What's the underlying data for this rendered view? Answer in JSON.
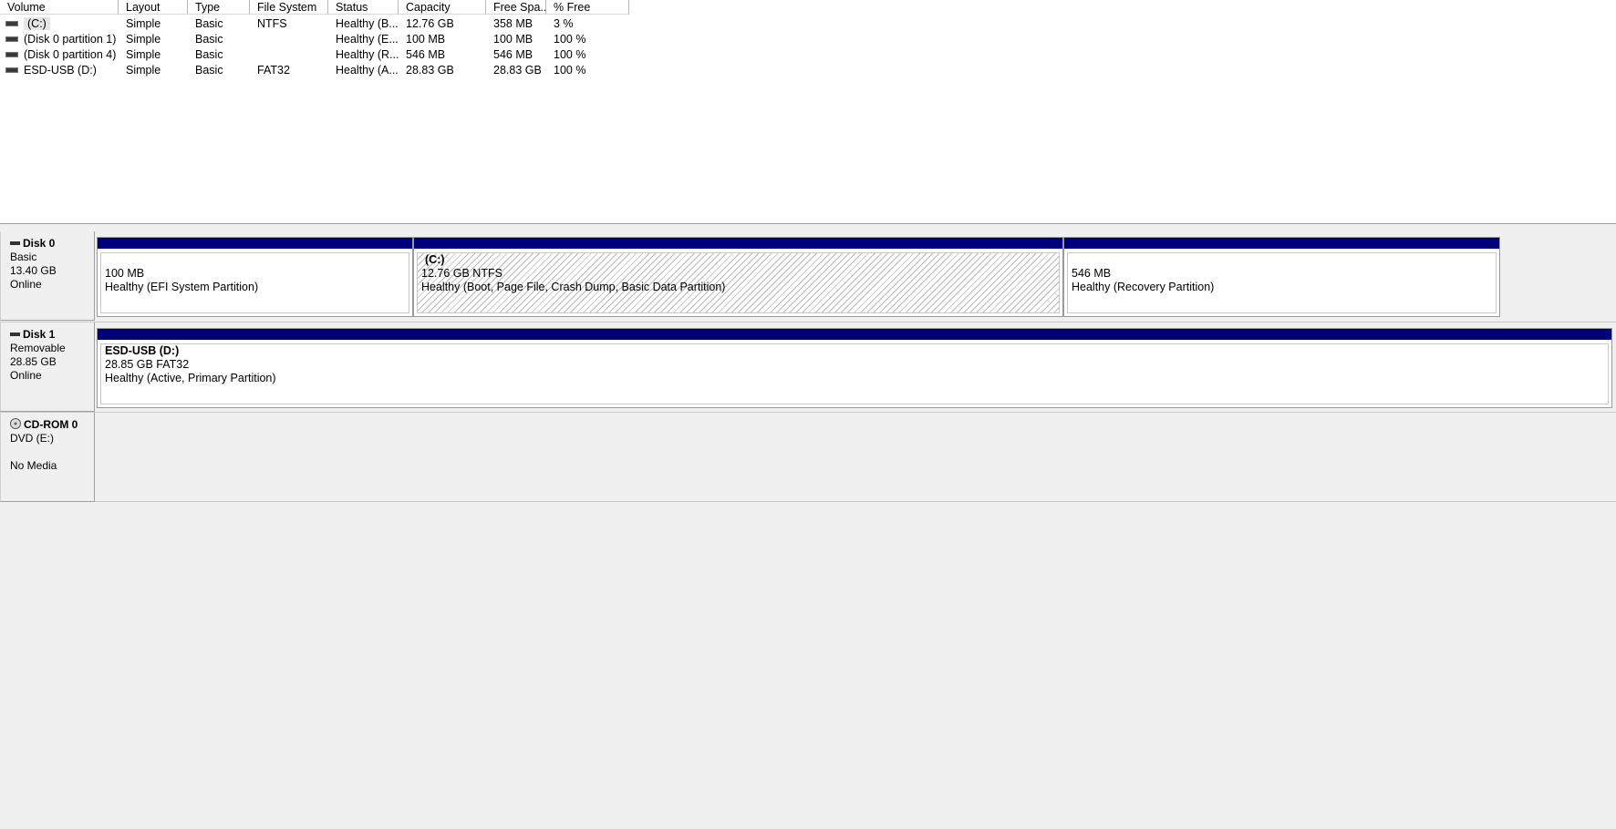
{
  "volume_list": {
    "columns": [
      "Volume",
      "Layout",
      "Type",
      "File System",
      "Status",
      "Capacity",
      "Free Spa...",
      "% Free"
    ],
    "rows": [
      {
        "volume": "(C:)",
        "layout": "Simple",
        "type": "Basic",
        "fs": "NTFS",
        "status": "Healthy (B...",
        "capacity": "12.76 GB",
        "free": "358 MB",
        "pct": "3 %"
      },
      {
        "volume": "(Disk 0 partition 1)",
        "layout": "Simple",
        "type": "Basic",
        "fs": "",
        "status": "Healthy (E...",
        "capacity": "100 MB",
        "free": "100 MB",
        "pct": "100 %"
      },
      {
        "volume": "(Disk 0 partition 4)",
        "layout": "Simple",
        "type": "Basic",
        "fs": "",
        "status": "Healthy (R...",
        "capacity": "546 MB",
        "free": "546 MB",
        "pct": "100 %"
      },
      {
        "volume": "ESD-USB (D:)",
        "layout": "Simple",
        "type": "Basic",
        "fs": "FAT32",
        "status": "Healthy (A...",
        "capacity": "28.83 GB",
        "free": "28.83 GB",
        "pct": "100 %"
      }
    ]
  },
  "disks": [
    {
      "title": "Disk 0",
      "kind": "Basic",
      "size": "13.40 GB",
      "state": "Online",
      "partitions": [
        {
          "name": "",
          "size": "100 MB",
          "status": "Healthy (EFI System Partition)"
        },
        {
          "name": "(C:)",
          "size": "12.76 GB NTFS",
          "status": "Healthy (Boot, Page File, Crash Dump, Basic Data Partition)"
        },
        {
          "name": "",
          "size": "546 MB",
          "status": "Healthy (Recovery Partition)"
        }
      ]
    },
    {
      "title": "Disk 1",
      "kind": "Removable",
      "size": "28.85 GB",
      "state": "Online",
      "partitions": [
        {
          "name": "ESD-USB  (D:)",
          "size": "28.85 GB FAT32",
          "status": "Healthy (Active, Primary Partition)"
        }
      ]
    },
    {
      "title": "CD-ROM 0",
      "kind": "DVD (E:)",
      "size": "",
      "state": "No Media"
    }
  ],
  "colors": {
    "partition_bar": "#00007b",
    "background": "#f0f0f0"
  },
  "icons": {
    "volume": "drive-icon",
    "disk": "disk-icon",
    "cdrom": "cdrom-icon"
  }
}
